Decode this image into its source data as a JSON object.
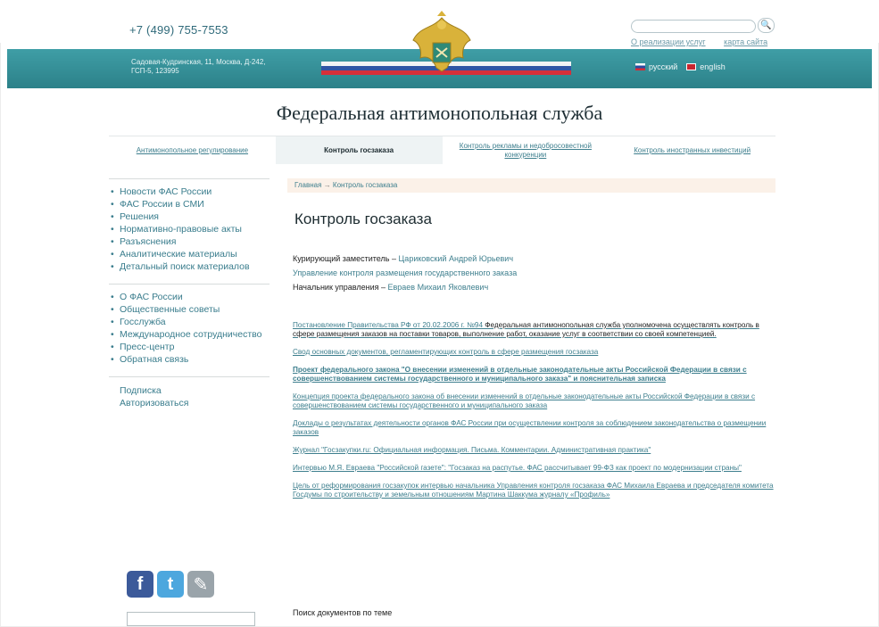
{
  "header": {
    "phone": "+7 (499) 755-7553",
    "address": "Садовая-Кудринская, 11, Москва, Д-242, ГСП-5, 123995",
    "search_placeholder": "",
    "search_button": "🔍",
    "top_links": [
      "О реализации услуг",
      "карта сайта"
    ],
    "languages": [
      "русский",
      "english"
    ]
  },
  "site_title": "Федеральная антимонопольная служба",
  "tabs": [
    "Антимонопольное регулирование",
    "Контроль госзаказа",
    "Контроль рекламы и недобросовестной конкуренции",
    "Контроль иностранных инвестиций"
  ],
  "sidebar": {
    "nav1": [
      "Новости ФАС России",
      "ФАС России в СМИ",
      "Решения",
      "Нормативно-правовые акты",
      "Разъяснения",
      "Аналитические материалы",
      "Детальный поиск материалов"
    ],
    "nav2": [
      "О ФАС России",
      "Общественные советы",
      "Госслужба",
      "Международное сотрудничество",
      "Пресс-центр",
      "Обратная связь"
    ],
    "links": [
      "Подписка",
      "Авторизоваться"
    ]
  },
  "main": {
    "breadcrumb": [
      "Главная",
      "Контроль госзаказа"
    ],
    "title": "Контроль госзаказа",
    "curators": {
      "deputy_label": "Курирующий заместитель",
      "deputy_name": "Царикoвский Андрей Юрьевич",
      "department": "Управление контроля размещения государственного заказа",
      "head_label": "Начальник управления",
      "head_name": "Евраев Михаил Яковлевич"
    },
    "docs": [
      {
        "link": "Постановление Правительства РФ от 20.02.2006 г. №94",
        "text": " Федеральная антимонопольная служба уполномочена осуществлять контроль в сфере размещения заказов на поставки товаров, выполнение работ, оказание услуг в соответствии со своей компетенцией.",
        "bold": false
      },
      {
        "link": "Свод основных документов, регламентирующих контроль в сфере размещения госзаказа",
        "text": "",
        "bold": false
      },
      {
        "link": "Проект федерального закона \"О внесении изменений в отдельные законодательные акты Российской Федерации в связи с совершенствованием системы государственного и муниципального заказа\" и пояснительная записка",
        "text": "",
        "bold": true
      },
      {
        "link": "Концепция проекта федерального закона об внесении изменений в отдельные законодательные акты Российской Федерации в связи с совершенствованием системы государственного и муниципального заказа",
        "text": "",
        "bold": false
      },
      {
        "link": "Доклады о результатах деятельности органов ФАС России при осуществлении контроля за соблюдением законодательства о размещении заказов",
        "text": "",
        "bold": false
      },
      {
        "link": "Журнал \"Госзакупки.ru: Официальная информация. Письма. Комментарии. Административная практика\"",
        "text": "",
        "bold": false
      },
      {
        "link": "Интервью М.Я. Евраева \"Российской газете\": \"Госзаказ на распутье. ФАС рассчитывает 99-ФЗ как проект по модернизации страны\"",
        "text": "",
        "bold": false
      },
      {
        "link": "Цель от реформирования госзакупок интервью начальника Управления контроля госзаказа ФАС Михаила Евраева и председателя комитета Госдумы по строительству и земельным отношениям Мартина Шаккума журналу «Профиль»",
        "text": "",
        "bold": false
      }
    ],
    "search_docs_label": "Поиск документов по теме"
  },
  "colors": {
    "banner": "#2c8189",
    "link": "#3e7f8e",
    "breadcrumb_bg": "#fbf1e8",
    "active_tab_bg": "#eef3f4"
  }
}
